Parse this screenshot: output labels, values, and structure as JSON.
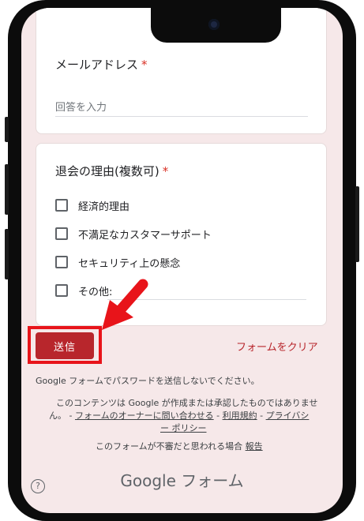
{
  "form": {
    "email_question": {
      "label": "メールアドレス",
      "required_mark": "*",
      "placeholder": "回答を入力"
    },
    "reason_question": {
      "label": "退会の理由(複数可)",
      "required_mark": "*",
      "options": [
        "経済的理由",
        "不満足なカスタマーサポート",
        "セキュリティ上の懸念",
        "その他:"
      ]
    },
    "submit_label": "送信",
    "clear_label": "フォームをクリア",
    "password_warning": "Google フォームでパスワードを送信しないでください。",
    "disclaimer": {
      "line1": "このコンテンツは Google が作成または承認したものではありませ",
      "line2_prefix": "ん。 - ",
      "contact_owner": "フォームのオーナーに問い合わせる",
      "sep1": " - ",
      "terms": "利用規約",
      "sep2": " - ",
      "privacy_part1": "プライバシ",
      "privacy_part2": "ー ポリシー"
    },
    "report_prefix": "このフォームが不審だと思われる場合",
    "report_link": "報告",
    "brand_google": "Google",
    "brand_form": "フォーム",
    "help_symbol": "?"
  },
  "colors": {
    "accent": "#b8262c",
    "highlight": "#e8141a",
    "background": "#f6e8e9"
  }
}
